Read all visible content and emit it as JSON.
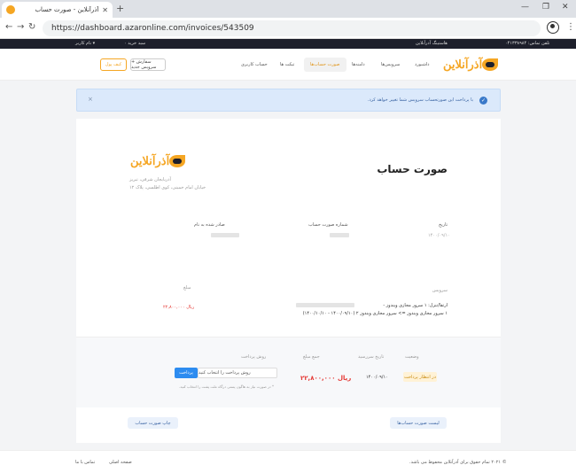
{
  "browser": {
    "tab_title": "آذرآنلاین - صورت حساب",
    "tab_close": "✕",
    "new_tab": "+",
    "url": "https://dashboard.azaronline.com/invoices/543509",
    "back": "←",
    "forward": "→",
    "reload": "↻",
    "menu": "⋮",
    "minimize": "—",
    "restore": "❐",
    "close": "✕"
  },
  "topbar": {
    "phone": "تلفن تماس: ۰۴۱۳۳۸۹۸۴",
    "hosting": "هاستینگ آذرآنلاین",
    "cart": "سبد خرید ۰",
    "user": "نام کاربر ▾"
  },
  "header": {
    "logo_text": "آذرآنلاین",
    "nav": [
      "داشبورد",
      "سرویس‌ها",
      "دامنه‌ها",
      "صورت حساب‌ها",
      "تیکت ها",
      "حساب کاربری"
    ],
    "order_button": "+ سفارش سرویس جدید",
    "wallet_button": "کیف پول"
  },
  "alert": {
    "text": "با پرداخت این صورتحساب سرویس شما تغییر خواهد کرد.",
    "icon": "✓",
    "close": "×"
  },
  "invoice": {
    "title": "صورت حساب",
    "company_name": "آذربایجان شرقی، تبریز",
    "company_address": "خیابان امام خمینی، کوی اطلسی، پلاک ۱۲",
    "date_label": "تاریخ",
    "date_value": "۱۴۰۰/۰۹/۱۰",
    "number_label": "شماره صورت حساب",
    "issued_label": "صادر شده به نام",
    "service_label": "سرویس",
    "amount_label": "مبلغ",
    "desc_line1": "ارتقا/تنزل: ۱ سرور مجازی ویندوز -",
    "desc_line2": "۱ سرور مجازی ویندوز => سرور مجازی ویندوز ۲ (۱۴۰۰/۰۹/۱۰ - ۱۴۰۰/۱۰/۱۰)",
    "line_amount": "۲۲,۸۰۰,۰۰۰ ریال",
    "summary": {
      "status_label": "وضعیت",
      "due_label": "تاریخ سررسید",
      "total_label": "جمع مبلغ",
      "method_label": "روش پرداخت",
      "status_value": "در انتظار پرداخت",
      "due_value": "۱۴۰۰/۰۹/۱۰",
      "total_value": "۲۲,۸۰۰,۰۰۰ ریال",
      "method_placeholder": "روش پرداخت را انتخاب کنید",
      "pay_button": "پرداخت",
      "note": "* در صورت نیاز به هاگون پستی درگاه ملت پشت را انتخاب کنید."
    },
    "back_to_list": "لیست صورت حساب‌ها",
    "print_button": "چاپ صورت حساب"
  },
  "footer": {
    "copyright": "© ۲۰۲۱ تمام حقوق برای آذرآنلاین محفوظ می باشد.",
    "home": "صفحه اصلی",
    "contact": "تماس با ما"
  },
  "colors": {
    "accent": "#f5a623",
    "primary": "#2d8cf0",
    "danger": "#e53935",
    "dark": "#1d1f2b"
  }
}
